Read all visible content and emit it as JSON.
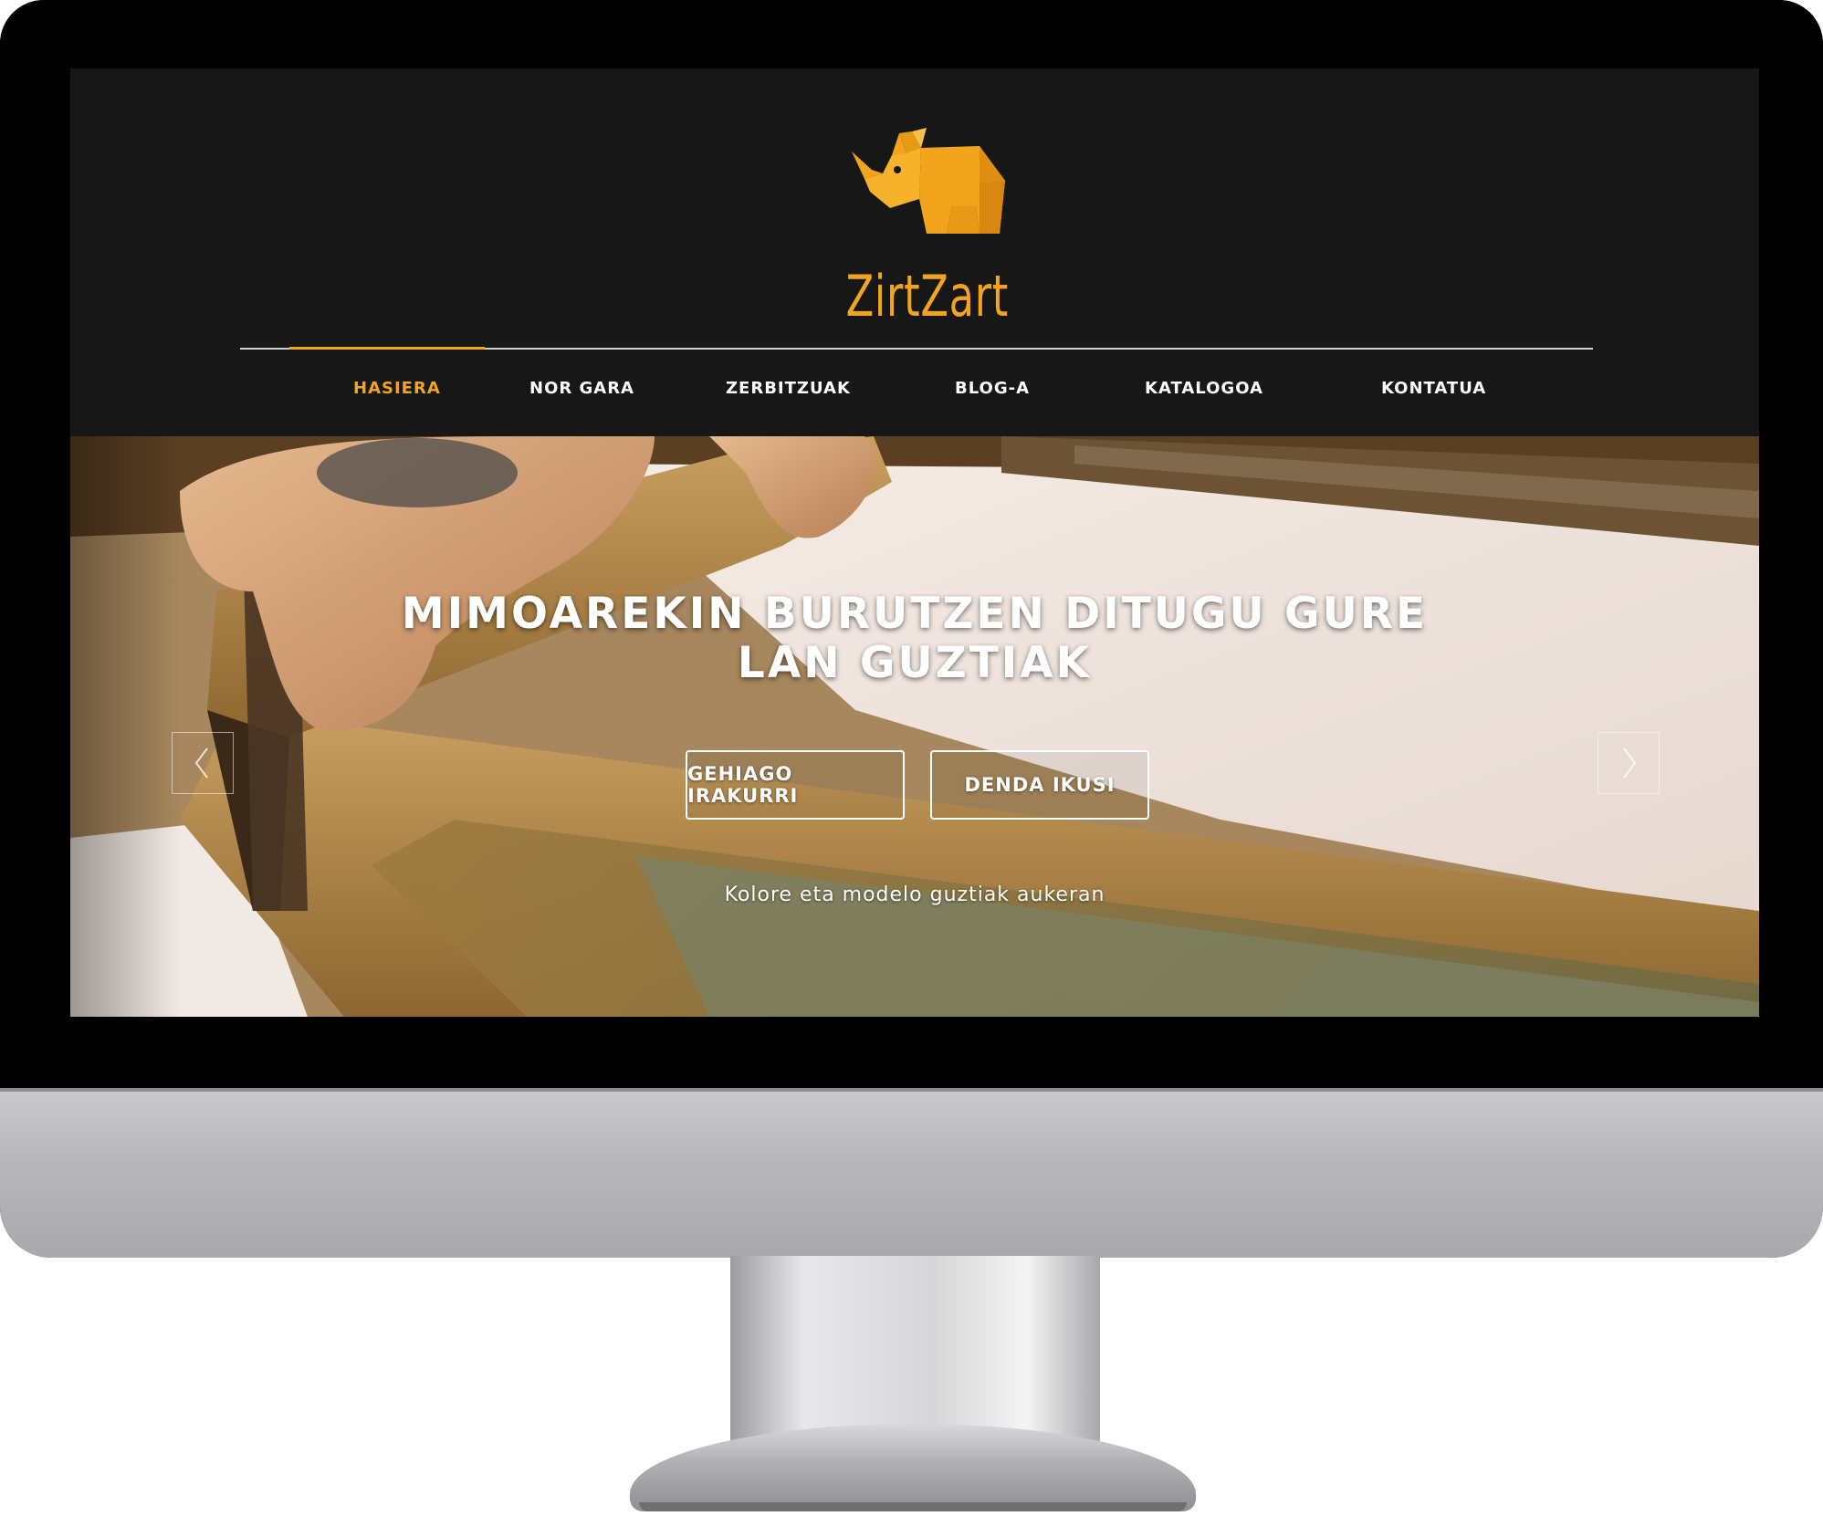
{
  "brand": {
    "name": "ZirtZart",
    "logo_icon": "rhino-icon",
    "accent_color": "#f2a51c"
  },
  "nav": {
    "items": [
      {
        "label": "HASIERA",
        "active": true
      },
      {
        "label": "NOR GARA",
        "active": false
      },
      {
        "label": "ZERBITZUAK",
        "active": false
      },
      {
        "label": "BLOG-A",
        "active": false
      },
      {
        "label": "KATALOGOA",
        "active": false
      },
      {
        "label": "KONTATUA",
        "active": false
      }
    ]
  },
  "hero": {
    "title_line1": "MIMOAREKIN BURUTZEN DITUGU GURE",
    "title_line2": "LAN GUZTIAK",
    "button_more": "GEHIAGO IRAKURRI",
    "button_shop": "DENDA IKUSI",
    "subtitle": "Kolore eta modelo guztiak aukeran",
    "prev_icon": "chevron-left-icon",
    "next_icon": "chevron-right-icon"
  }
}
